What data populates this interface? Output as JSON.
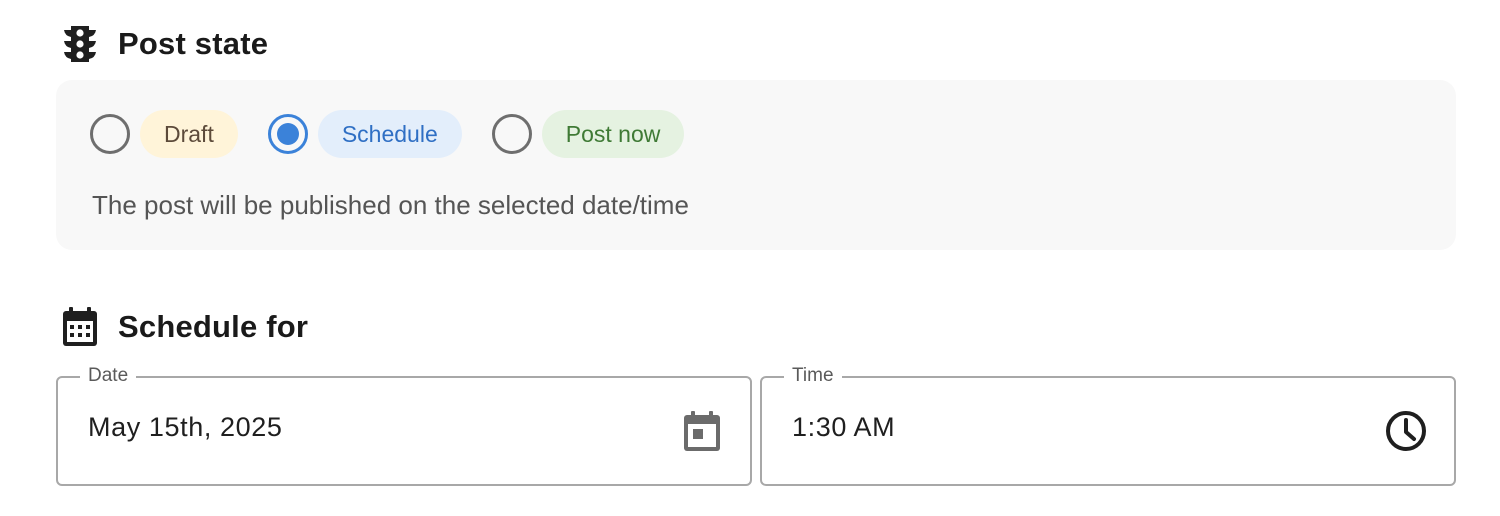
{
  "post_state": {
    "title": "Post state",
    "icon": "traffic-light-icon",
    "options": [
      {
        "label": "Draft",
        "checked": false,
        "color": "#fff4d9"
      },
      {
        "label": "Schedule",
        "checked": true,
        "color": "#e3eefb"
      },
      {
        "label": "Post now",
        "checked": false,
        "color": "#e5f2e1"
      }
    ],
    "description": "The post will be published on the selected date/time",
    "accent_color": "#3b82d9"
  },
  "schedule_for": {
    "title": "Schedule for",
    "icon": "calendar-icon",
    "date": {
      "label": "Date",
      "value": "May 15th, 2025",
      "icon": "calendar-icon"
    },
    "time": {
      "label": "Time",
      "value": "1:30 AM",
      "icon": "clock-icon"
    }
  }
}
